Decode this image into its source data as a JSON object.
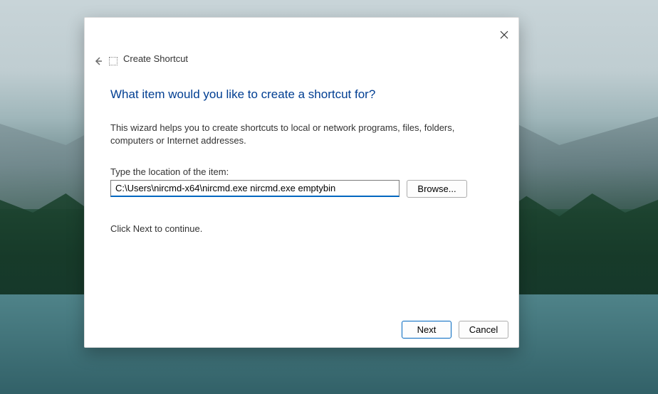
{
  "dialog": {
    "title": "Create Shortcut",
    "heading": "What item would you like to create a shortcut for?",
    "description": "This wizard helps you to create shortcuts to local or network programs, files, folders, computers or Internet addresses.",
    "field_label": "Type the location of the item:",
    "location_value": "C:\\Users\\nircmd-x64\\nircmd.exe nircmd.exe emptybin",
    "browse_label": "Browse...",
    "continue_text": "Click Next to continue.",
    "next_label": "Next",
    "cancel_label": "Cancel"
  }
}
